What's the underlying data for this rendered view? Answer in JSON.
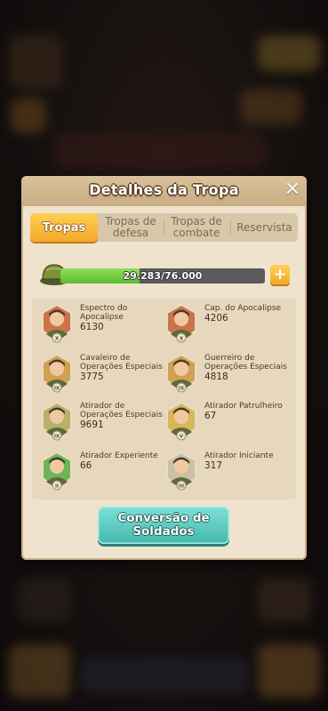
{
  "modal": {
    "title": "Detalhes da Tropa",
    "close_icon": "close-icon"
  },
  "tabs": [
    {
      "label": "Tropas",
      "active": true
    },
    {
      "label": "Tropas de defesa",
      "active": false
    },
    {
      "label": "Tropas de combate",
      "active": false
    },
    {
      "label": "Reservista",
      "active": false
    }
  ],
  "capacity": {
    "text": "29.283/76.000",
    "current": 29283,
    "max": 76000,
    "icon": "helmet-icon"
  },
  "troops": [
    {
      "name": "Espectro do Apocalipse",
      "count": "6130",
      "rank": "X",
      "icon": "soldier-portrait-icon",
      "color": "#c9744a"
    },
    {
      "name": "Cap. do Apocalipse",
      "count": "4206",
      "rank": "X",
      "icon": "soldier-portrait-icon",
      "color": "#c9744a"
    },
    {
      "name": "Cavaleiro de Operações Especiais",
      "count": "3775",
      "rank": "IX",
      "icon": "soldier-portrait-icon",
      "color": "#d0a055"
    },
    {
      "name": "Guerreiro de Operações Especiais",
      "count": "4818",
      "rank": "IX",
      "icon": "soldier-portrait-icon",
      "color": "#d0a055"
    },
    {
      "name": "Atirador de Operações Especiais",
      "count": "9691",
      "rank": "IX",
      "icon": "sniper-portrait-icon",
      "color": "#b8b16a"
    },
    {
      "name": "Atirador Patrulheiro",
      "count": "67",
      "rank": "V",
      "icon": "sniper-portrait-icon",
      "color": "#d6b85a"
    },
    {
      "name": "Atirador Experiente",
      "count": "66",
      "rank": "II",
      "icon": "sniper-portrait-icon",
      "color": "#6eb55a"
    },
    {
      "name": "Atirador Iniciante",
      "count": "317",
      "rank": "III",
      "icon": "sniper-portrait-icon",
      "color": "#c8c0a8"
    }
  ],
  "convert_button": {
    "label": "Conversão de Soldados"
  }
}
